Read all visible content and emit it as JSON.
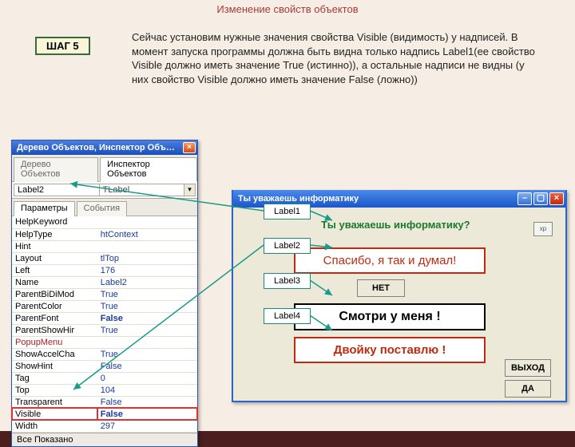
{
  "slide": {
    "title": "Изменение свойств объектов",
    "step_label": "ШАГ 5",
    "explain": "Сейчас установим нужные значения свойства Visible (видимость) у надписей. В момент запуска программы должна быть видна только надпись Label1(ее свойство Visible должно иметь значение True (истинно)), а остальные надписи не видны (у них свойство Visible должно иметь значение False (ложно))"
  },
  "inspector": {
    "window_title": "Дерево Объектов, Инспектор Объ…",
    "tab_tree": "Дерево Объектов",
    "tab_inspector": "Инспектор Объектов",
    "combo_name": "Label2",
    "combo_class": "TLabel",
    "tab_params": "Параметры",
    "tab_events": "События",
    "props": [
      {
        "name": "HelpKeyword",
        "val": ""
      },
      {
        "name": "HelpType",
        "val": "htContext"
      },
      {
        "name": "Hint",
        "val": ""
      },
      {
        "name": "Layout",
        "val": "tlTop"
      },
      {
        "name": "Left",
        "val": "176"
      },
      {
        "name": "Name",
        "val": "Label2"
      },
      {
        "name": "ParentBiDiMod",
        "val": "True"
      },
      {
        "name": "ParentColor",
        "val": "True"
      },
      {
        "name": "ParentFont",
        "val": "False",
        "bold": true
      },
      {
        "name": "ParentShowHir",
        "val": "True"
      },
      {
        "name": "PopupMenu",
        "val": "",
        "red": true
      },
      {
        "name": "ShowAccelCha",
        "val": "True"
      },
      {
        "name": "ShowHint",
        "val": "False"
      },
      {
        "name": "Tag",
        "val": "0"
      },
      {
        "name": "Top",
        "val": "104"
      },
      {
        "name": "Transparent",
        "val": "False"
      },
      {
        "name": "Visible",
        "val": "False",
        "bold": true,
        "highlight": true
      },
      {
        "name": "Width",
        "val": "297"
      }
    ],
    "footer": "Все Показано"
  },
  "app": {
    "title": "Ты уважаешь информатику",
    "question": "Ты уважаешь информатику?",
    "xp": "xp",
    "msg1": "Спасибо, я так и думал!",
    "btn_no": "НЕТ",
    "msg2": "Смотри у меня !",
    "msg3": "Двойку поставлю !",
    "btn_exit": "ВЫХОД",
    "btn_yes": "ДА"
  },
  "callouts": {
    "l1": "Label1",
    "l2": "Label2",
    "l3": "Label3",
    "l4": "Label4"
  }
}
